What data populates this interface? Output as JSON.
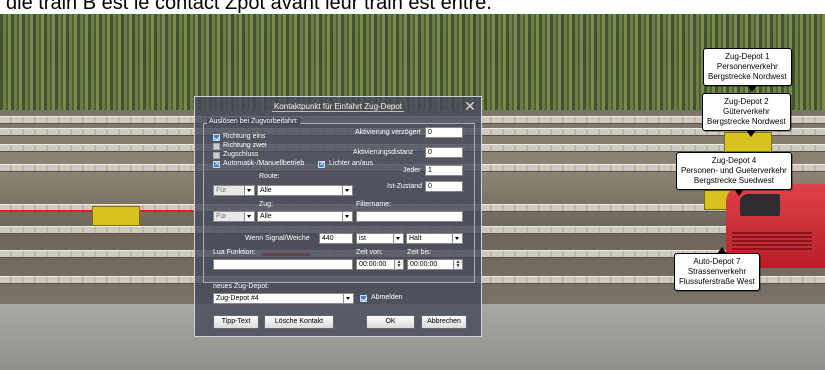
{
  "caption": "die train B est le contact Zpot avant leur train est entre.",
  "callouts": [
    {
      "lines": [
        "Zug-Depot 1",
        "Personenverkehr",
        "Bergstrecke Nordwest"
      ]
    },
    {
      "lines": [
        "Zug-Depot 2",
        "Güterverkehr",
        "Bergstrecke Nordwest"
      ]
    },
    {
      "lines": [
        "Zug-Depot 4",
        "Personen- und Gueterverkehr",
        "Bergstrecke Suedwest"
      ]
    },
    {
      "lines": [
        "Auto-Depot 7",
        "Strassenverkehr",
        "Flussuferstraße West"
      ]
    }
  ],
  "dialog": {
    "title": "Kontaktpunkt für Einfahrt Zug-Depot",
    "group_label": "Auslösen bei Zugvorbeifahrt:",
    "checkboxes": [
      {
        "label": "Richtung eins",
        "checked": true
      },
      {
        "label": "Richtung zwei",
        "checked": false
      },
      {
        "label": "Zugschluss",
        "checked": false
      },
      {
        "label": "Automatik-/Manuellbetrieb",
        "checked": true
      },
      {
        "label": "Lichter an/aus",
        "checked": true
      }
    ],
    "aktivierung_verzoegert_label": "Aktivierung verzögert",
    "aktivierung_verzoegert_value": "0",
    "aktivierungsdistanz_label": "Aktivierungsdistanz",
    "aktivierungsdistanz_value": "0",
    "jeder_label": "Jeder",
    "jeder_value": "1",
    "ist_zustand_label": "Ist-Zustand",
    "ist_zustand_value": "0",
    "route_label": "Route:",
    "route_mode": "Für",
    "route_value": "Alle",
    "zug_label": "Zug:",
    "zug_mode": "Für",
    "zug_value": "Alle",
    "filtername_label": "Filtername:",
    "filtername_value": "",
    "wenn_signal_label": "Wenn Signal/Weiche",
    "wenn_signal_value": "440",
    "wenn_op": "ist",
    "wenn_state": "Halt",
    "lua_label": "Lua Funktion:",
    "lua_value": "",
    "zeit_von_label": "Zeit von:",
    "zeit_von_value": "00:00:00",
    "zeit_bis_label": "Zeit bis:",
    "zeit_bis_value": "00:00:00",
    "neues_label": "neues Zug-Depot:",
    "neues_value": "Zug-Depot #4",
    "abmelden_label": "Abmelden",
    "abmelden_checked": true,
    "btn_tipp": "Tipp-Text",
    "btn_loesche": "Lösche Kontakt",
    "btn_ok": "OK",
    "btn_abbrechen": "Abbrechen"
  }
}
